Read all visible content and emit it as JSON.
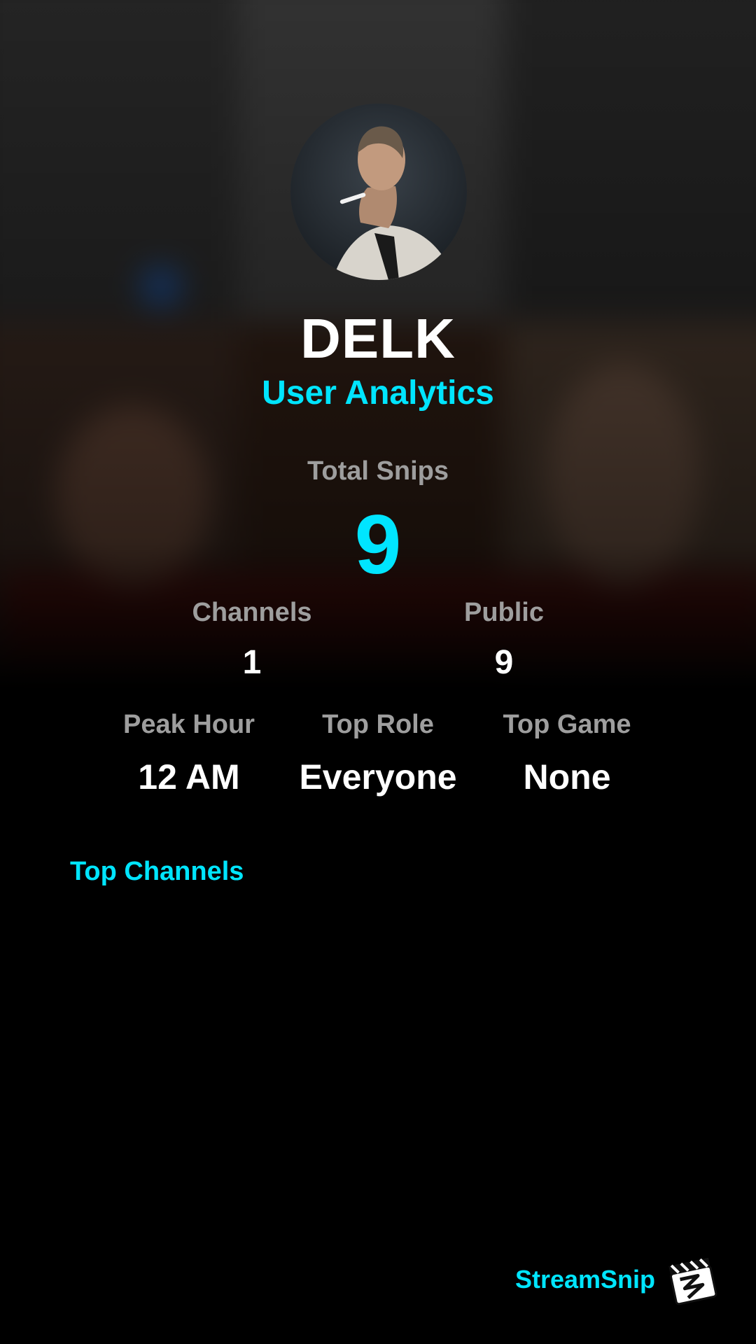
{
  "profile": {
    "username": "DELK",
    "subtitle": "User Analytics"
  },
  "stats": {
    "total_snips_label": "Total Snips",
    "total_snips_value": "9",
    "channels_label": "Channels",
    "channels_value": "1",
    "public_label": "Public",
    "public_value": "9",
    "peak_hour_label": "Peak Hour",
    "peak_hour_value": "12 AM",
    "top_role_label": "Top Role",
    "top_role_value": "Everyone",
    "top_game_label": "Top Game",
    "top_game_value": "None"
  },
  "sections": {
    "top_channels_title": "Top Channels"
  },
  "brand": {
    "name": "StreamSnip",
    "logo_icon": "clapperboard-icon"
  },
  "colors": {
    "accent": "#00e5ff",
    "label_gray": "#9e9e9e",
    "text_white": "#ffffff",
    "background": "#000000"
  }
}
